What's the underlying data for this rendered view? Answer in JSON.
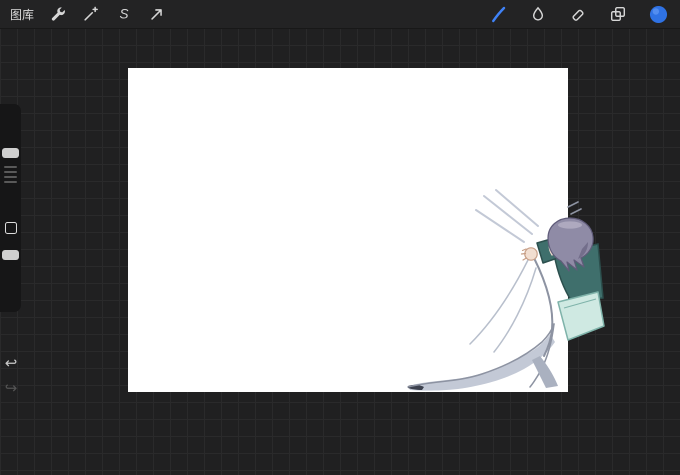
{
  "topbar": {
    "gallery_label": "图库",
    "icon_color": "#d6d6d6",
    "active_color": "#3f82f7",
    "color_swatch": "#2f72e4",
    "left_tools": [
      {
        "name": "actions",
        "icon": "wrench-icon"
      },
      {
        "name": "adjustments",
        "icon": "magic-wand-icon"
      },
      {
        "name": "selection",
        "icon": "selection-s-icon",
        "glyph": "S"
      },
      {
        "name": "transform",
        "icon": "transform-arrow-icon"
      }
    ],
    "right_tools": [
      {
        "name": "paint",
        "icon": "paint-brush-icon",
        "active": true
      },
      {
        "name": "smudge",
        "icon": "smudge-icon",
        "active": false
      },
      {
        "name": "erase",
        "icon": "eraser-icon",
        "active": false
      },
      {
        "name": "layers",
        "icon": "layers-icon",
        "active": false
      }
    ]
  },
  "sidebar": {
    "undo_glyph": "↩",
    "redo_glyph": "↪"
  },
  "canvas": {
    "background": "#ffffff",
    "colors": {
      "hair": "#8f8ba6",
      "hair_dark": "#605c7a",
      "hair_light": "#bab6cb",
      "skin": "#f2ded0",
      "skin_line": "#c79e86",
      "shirt": "#3f6f6c",
      "shirt_dark": "#2c4f4d",
      "pillow": "#cfe9e2",
      "pillow_edge": "#7fb3aa",
      "sheet_line": "#8d93a2",
      "sheet_fold": "#b8bfcc",
      "sheet_streak": "#c3c9d6",
      "sheet_shadow": "#c3c9d6",
      "shadow_dark": "#aab1c0",
      "ink_dark": "#3c414e"
    }
  }
}
